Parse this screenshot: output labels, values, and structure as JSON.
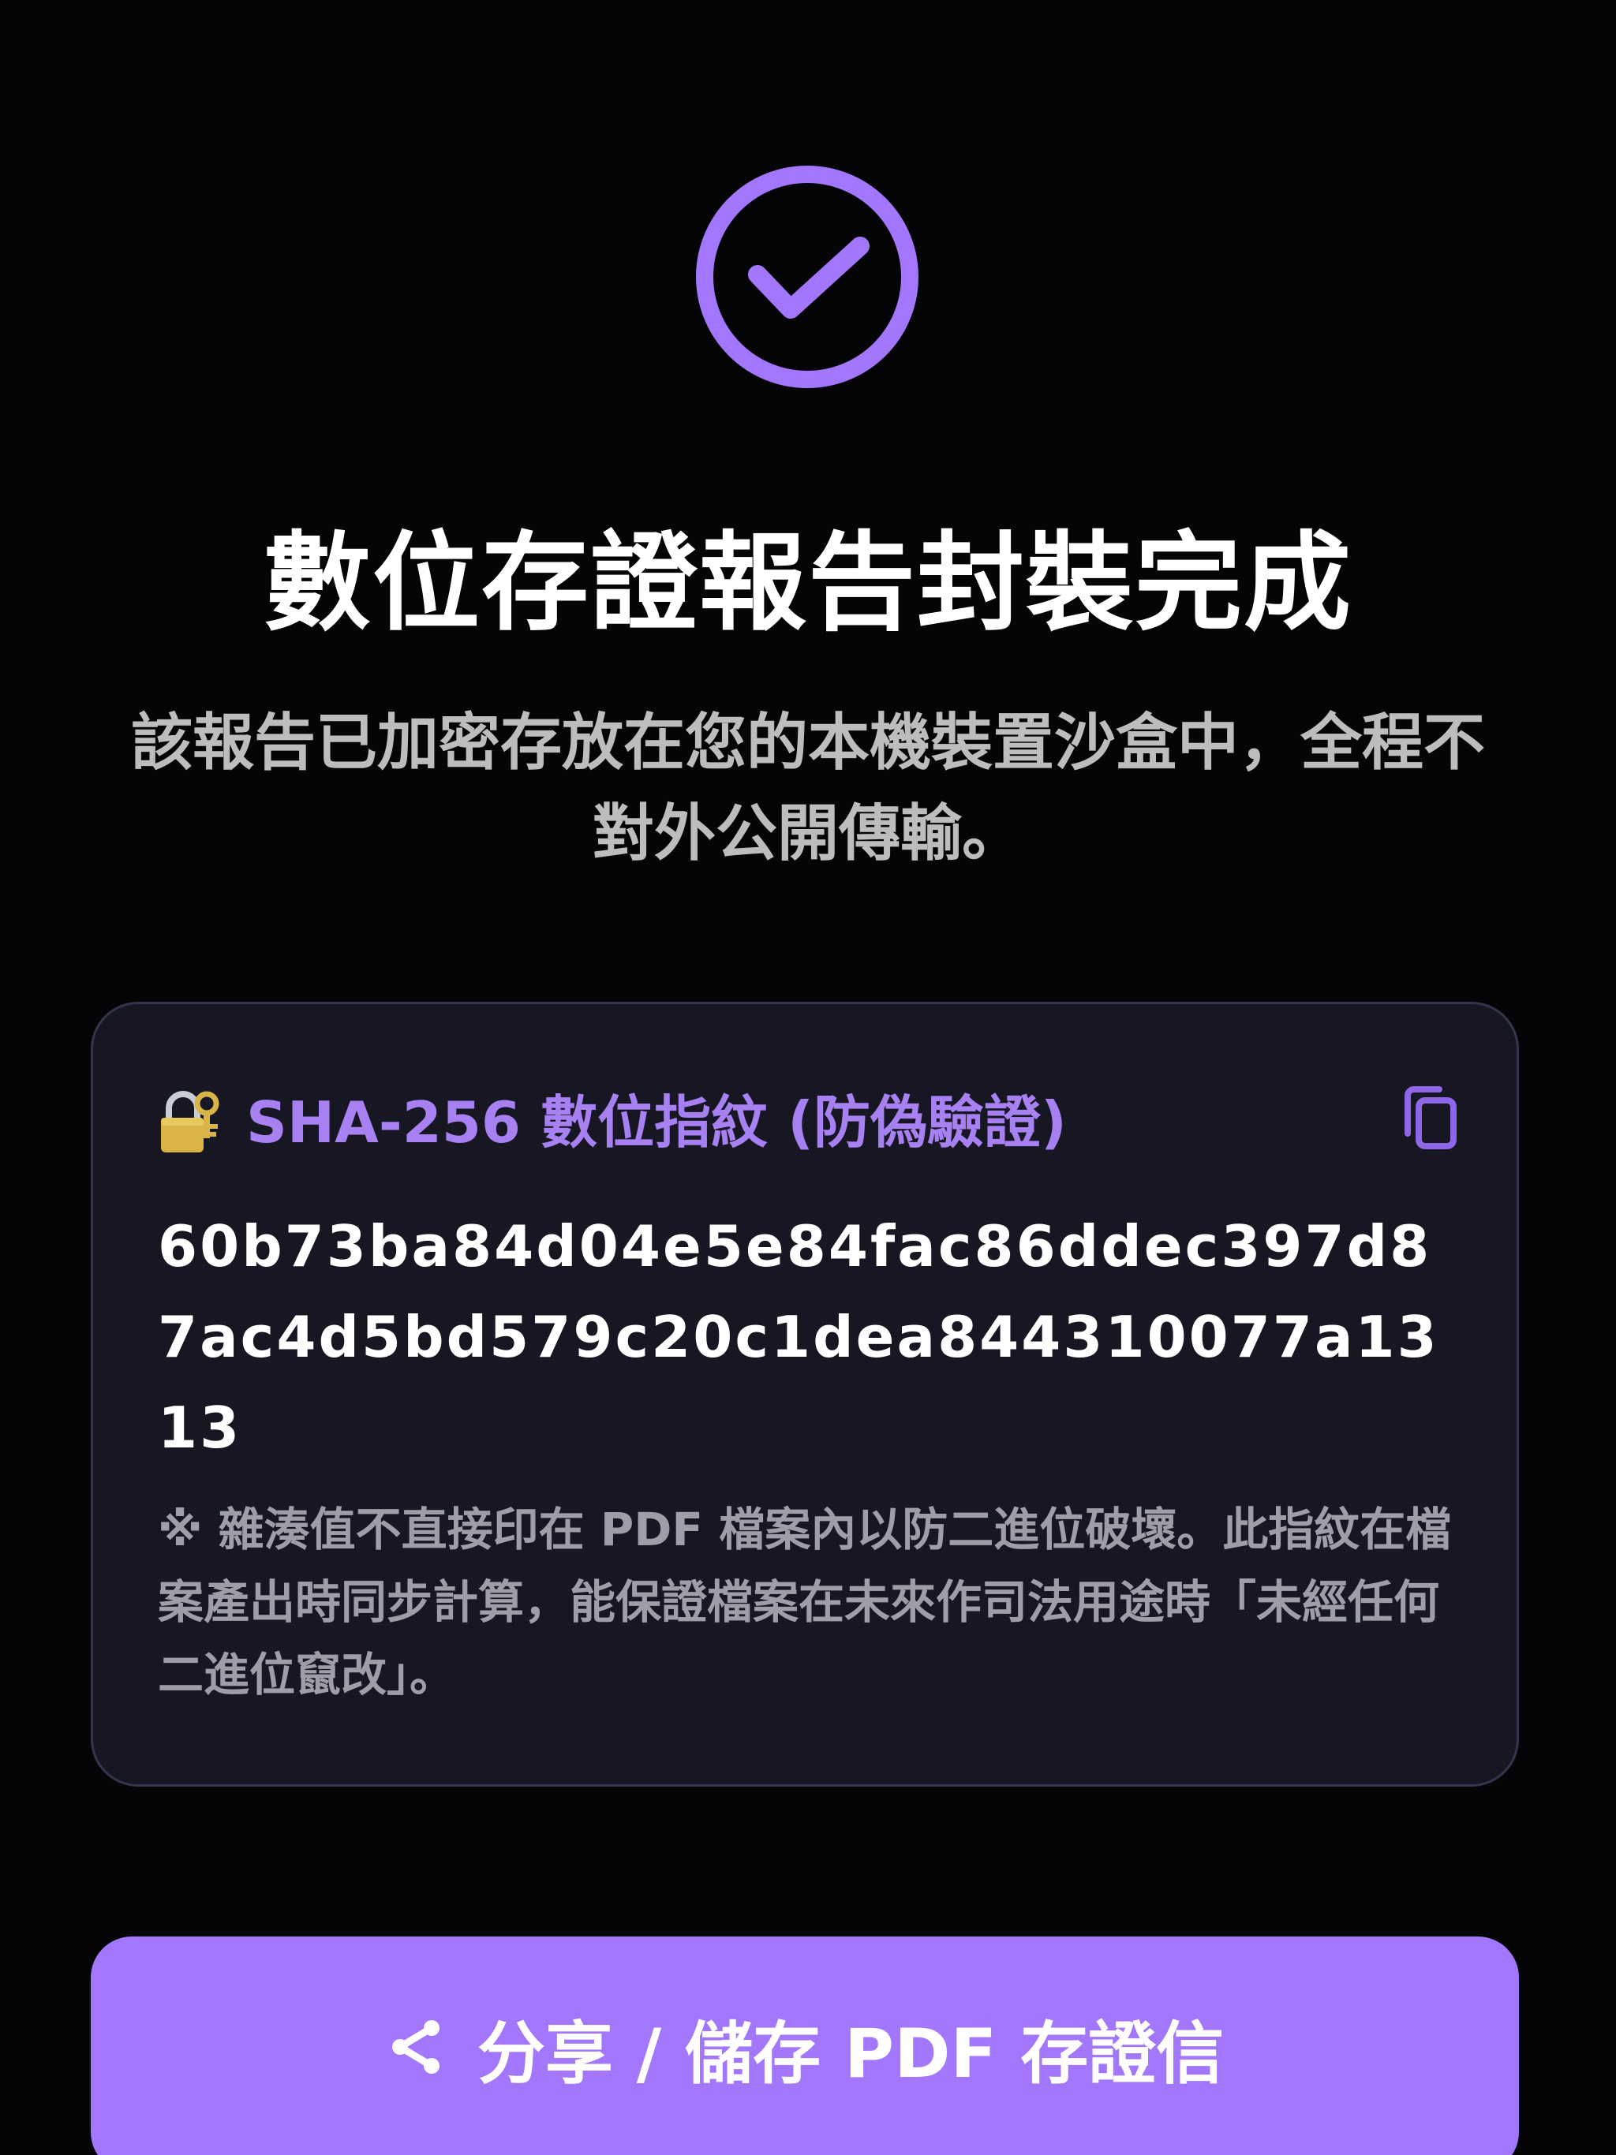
{
  "colors": {
    "background": "#050507",
    "accent": "#A277FB",
    "card_background": "#161723",
    "card_border": "#34344D",
    "muted_text": "#9E9EA8"
  },
  "status": {
    "icon": "check-circle-icon"
  },
  "title": "數位存證報告封裝完成",
  "subtitle": "該報告已加密存放在您的本機裝置沙盒中，全程不對外公開傳輸。",
  "fingerprint_card": {
    "lock_icon": "locked-with-key-icon",
    "title": "SHA-256 數位指紋 (防偽驗證)",
    "copy_icon": "copy-icon",
    "hash": "60b73ba84d04e5e84fac86ddec397d87ac4d5bd579c20c1dea844310077a1313",
    "note": "※ 雜湊值不直接印在 PDF 檔案內以防二進位破壞。此指紋在檔案產出時同步計算，能保證檔案在未來作司法用途時「未經任何二進位竄改」。"
  },
  "share_button": {
    "icon": "share-icon",
    "label": "分享 / 儲存 PDF 存證信"
  }
}
